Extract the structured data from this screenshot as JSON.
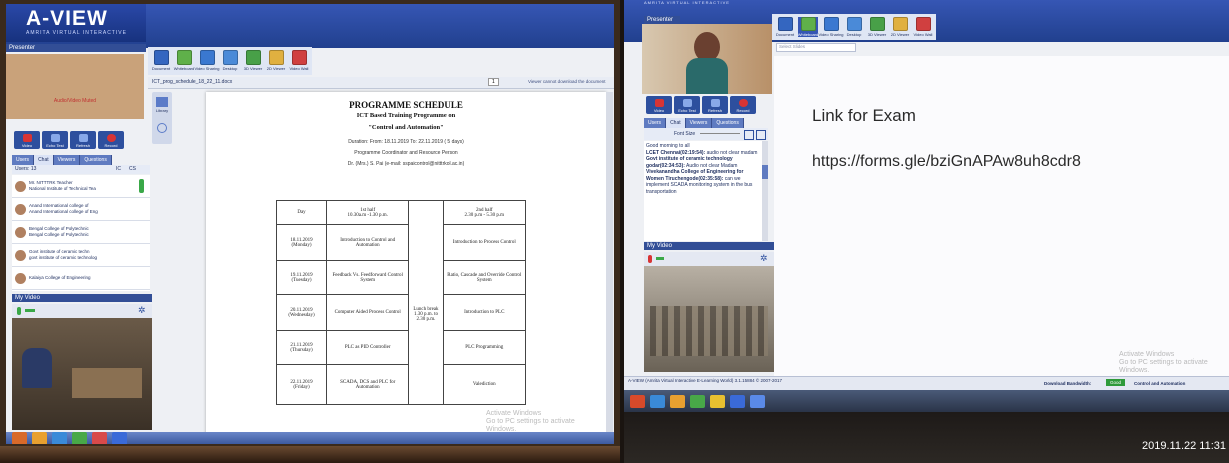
{
  "left": {
    "logo": {
      "title": "A-VIEW",
      "subtitle": "AMRITA VIRTUAL INTERACTIVE"
    },
    "presenter_label": "Presenter",
    "presenter_status": "Audio/Video Muted",
    "toolbar": [
      "Document",
      "Whiteboard",
      "Video Sharing",
      "Desktop",
      "3D Viewer",
      "2D Viewer",
      "Video Wall"
    ],
    "document_name": "ICT_prog_schedule_18_22_11.docx",
    "page_number": "1",
    "download_note": "Viewer cannot download the document",
    "library_label": "Library",
    "controls": [
      "Video",
      "Echo Test",
      "Refresh",
      "Record"
    ],
    "tabs": [
      "Users",
      "Chat",
      "Viewers",
      "Questions"
    ],
    "users_count": "Users: 13",
    "column_headers": [
      "IC",
      "CS"
    ],
    "users": [
      "Mr. NITTTRK Teacher",
      "National Institute of Technical Tea",
      "Anand International college of",
      "Anand International college of Eng",
      "Bengal College of Polytechnic",
      "Bengal College of Polytechnic",
      "Govt institute of ceramic techn",
      "govt institute of ceramic technolog",
      "Kalaiya College of Engineering"
    ],
    "my_video": "My Video",
    "doc": {
      "title": "PROGRAMME SCHEDULE",
      "subtitle": "ICT Based Training Programme on",
      "topic": "\"Control and Automation\"",
      "duration": "Duration: From: 18.11.2019 To: 22.11.2019 ( 5 days)",
      "coordinator": "Programme Coordinator and Resource Person",
      "contact": "Dr. (Mrs.) S. Pai (e-mail: sspaicontrol@nitttrkol.ac.in)",
      "table": {
        "header": [
          "Day",
          "1st half\n10.30a.m -1.30 p.m.",
          "2nd half\n2.30 p.m - 5.30 p.m"
        ],
        "lunch": "Lunch break 1.30 p.m. to 2.30 p.m.",
        "rows": [
          [
            "18.11.2019\n(Monday)",
            "Introduction to Control and Automation",
            "Introduction to Process Control"
          ],
          [
            "19.11.2019\n(Tuesday)",
            "Feedback Vs. Feedforward Control System",
            "Ratio, Cascade and Override Control System"
          ],
          [
            "20.11.2019\n(Wednesday)",
            "Computer Aided Process Control",
            "Introduction to PLC"
          ],
          [
            "21.11.2019\n(Thursday)",
            "PLC as PID Controller",
            "PLC Programming"
          ],
          [
            "22.11.2019\n(Friday)",
            "SCADA, DCS and PLC for Automation",
            "Valediction"
          ]
        ]
      }
    },
    "watermark": "Activate Windows\nGo to PC settings to activate Windows."
  },
  "right": {
    "header_text": "AMRITA VIRTUAL INTERACTIVE",
    "presenter_label": "Presenter",
    "toolbar": [
      "Document",
      "Whiteboard",
      "Video Sharing",
      "Desktop",
      "3D Viewer",
      "2D Viewer",
      "Video Wall"
    ],
    "whiteboard_selector": "Select Slides",
    "controls": [
      "Video",
      "Echo Test",
      "Refresh",
      "Record"
    ],
    "tabs": [
      "Users",
      "Chat",
      "Viewers",
      "Questions"
    ],
    "font_size_label": "Font Size",
    "chat": [
      {
        "from": "",
        "text": "Good morning to all"
      },
      {
        "from": "LCET Chennai(02:19:54):",
        "text": "audio not clear madam"
      },
      {
        "from": "Govt institute of ceramic technology godar(02:34:53):",
        "text": "Audio not clear Madam"
      },
      {
        "from": "Vivekanandha College of Engineering for Women Tiruchengode(02:35:58):",
        "text": "can we implement SCADA monitoring system in the bus transportation"
      }
    ],
    "my_video": "My Video",
    "whiteboard_heading": "Link for Exam",
    "whiteboard_link": "https://forms.gle/bziGnAPAw8uh8cdr8",
    "status_bar": "A-VIEW (Amrita Virtual Interactive E-Learning World) 3.1.15884 © 2007-2017",
    "download_bandwidth": "Download Bandwidth:",
    "bandwidth_value": "Good",
    "course_name": "Control and Automation",
    "watermark": "Activate Windows\nGo to PC settings to activate Windows.",
    "timestamp": "2019.11.22  11:31"
  },
  "colors": {
    "accent_blue": "#2d4f9e",
    "toolbar_blue": "#3656b4",
    "record_red": "#d83434",
    "bandwidth_green": "#2e9a3a"
  }
}
